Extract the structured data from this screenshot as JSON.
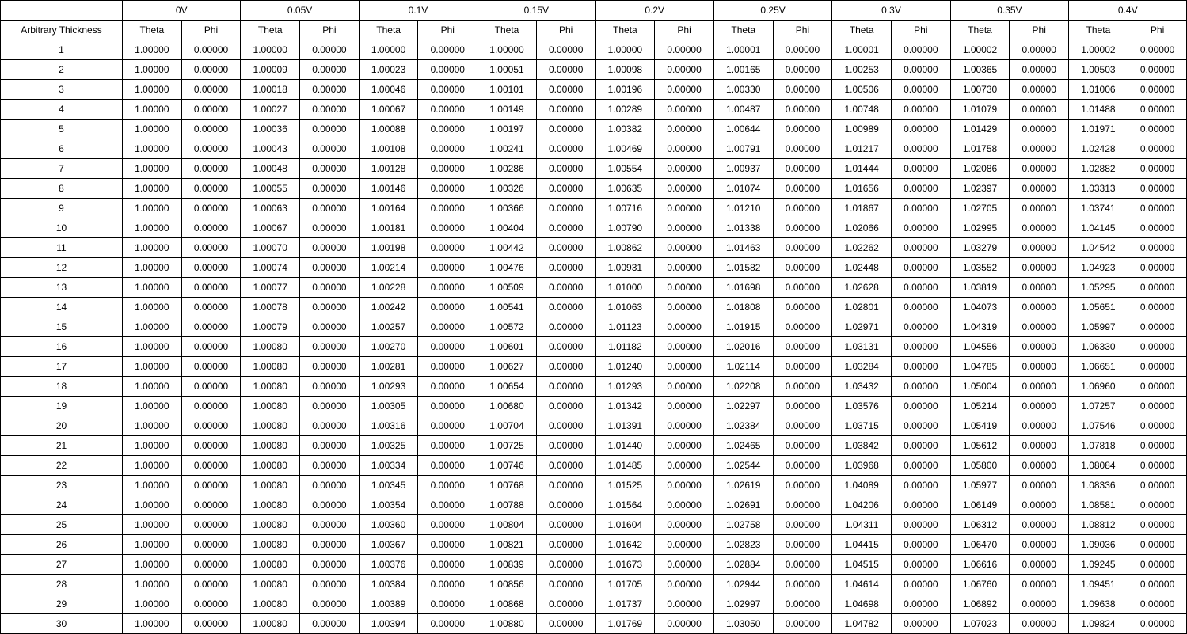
{
  "row_header_label": "Arbitrary Thickness",
  "voltages": [
    "0V",
    "0.05V",
    "0.1V",
    "0.15V",
    "0.2V",
    "0.25V",
    "0.3V",
    "0.35V",
    "0.4V"
  ],
  "sub_headers": [
    "Theta",
    "Phi"
  ],
  "row_labels": [
    "1",
    "2",
    "3",
    "4",
    "5",
    "6",
    "7",
    "8",
    "9",
    "10",
    "11",
    "12",
    "13",
    "14",
    "15",
    "16",
    "17",
    "18",
    "19",
    "20",
    "21",
    "22",
    "23",
    "24",
    "25",
    "26",
    "27",
    "28",
    "29",
    "30"
  ],
  "chart_data": {
    "type": "table",
    "title": "",
    "xlabel": "",
    "ylabel": "",
    "row_header": "Arbitrary Thickness",
    "column_groups": [
      "0V",
      "0.05V",
      "0.1V",
      "0.15V",
      "0.2V",
      "0.25V",
      "0.3V",
      "0.35V",
      "0.4V"
    ],
    "sub_columns": [
      "Theta",
      "Phi"
    ],
    "rows": [
      {
        "id": "1",
        "values": [
          "1.00000",
          "0.00000",
          "1.00000",
          "0.00000",
          "1.00000",
          "0.00000",
          "1.00000",
          "0.00000",
          "1.00000",
          "0.00000",
          "1.00001",
          "0.00000",
          "1.00001",
          "0.00000",
          "1.00002",
          "0.00000",
          "1.00002",
          "0.00000"
        ]
      },
      {
        "id": "2",
        "values": [
          "1.00000",
          "0.00000",
          "1.00009",
          "0.00000",
          "1.00023",
          "0.00000",
          "1.00051",
          "0.00000",
          "1.00098",
          "0.00000",
          "1.00165",
          "0.00000",
          "1.00253",
          "0.00000",
          "1.00365",
          "0.00000",
          "1.00503",
          "0.00000"
        ]
      },
      {
        "id": "3",
        "values": [
          "1.00000",
          "0.00000",
          "1.00018",
          "0.00000",
          "1.00046",
          "0.00000",
          "1.00101",
          "0.00000",
          "1.00196",
          "0.00000",
          "1.00330",
          "0.00000",
          "1.00506",
          "0.00000",
          "1.00730",
          "0.00000",
          "1.01006",
          "0.00000"
        ]
      },
      {
        "id": "4",
        "values": [
          "1.00000",
          "0.00000",
          "1.00027",
          "0.00000",
          "1.00067",
          "0.00000",
          "1.00149",
          "0.00000",
          "1.00289",
          "0.00000",
          "1.00487",
          "0.00000",
          "1.00748",
          "0.00000",
          "1.01079",
          "0.00000",
          "1.01488",
          "0.00000"
        ]
      },
      {
        "id": "5",
        "values": [
          "1.00000",
          "0.00000",
          "1.00036",
          "0.00000",
          "1.00088",
          "0.00000",
          "1.00197",
          "0.00000",
          "1.00382",
          "0.00000",
          "1.00644",
          "0.00000",
          "1.00989",
          "0.00000",
          "1.01429",
          "0.00000",
          "1.01971",
          "0.00000"
        ]
      },
      {
        "id": "6",
        "values": [
          "1.00000",
          "0.00000",
          "1.00043",
          "0.00000",
          "1.00108",
          "0.00000",
          "1.00241",
          "0.00000",
          "1.00469",
          "0.00000",
          "1.00791",
          "0.00000",
          "1.01217",
          "0.00000",
          "1.01758",
          "0.00000",
          "1.02428",
          "0.00000"
        ]
      },
      {
        "id": "7",
        "values": [
          "1.00000",
          "0.00000",
          "1.00048",
          "0.00000",
          "1.00128",
          "0.00000",
          "1.00286",
          "0.00000",
          "1.00554",
          "0.00000",
          "1.00937",
          "0.00000",
          "1.01444",
          "0.00000",
          "1.02086",
          "0.00000",
          "1.02882",
          "0.00000"
        ]
      },
      {
        "id": "8",
        "values": [
          "1.00000",
          "0.00000",
          "1.00055",
          "0.00000",
          "1.00146",
          "0.00000",
          "1.00326",
          "0.00000",
          "1.00635",
          "0.00000",
          "1.01074",
          "0.00000",
          "1.01656",
          "0.00000",
          "1.02397",
          "0.00000",
          "1.03313",
          "0.00000"
        ]
      },
      {
        "id": "9",
        "values": [
          "1.00000",
          "0.00000",
          "1.00063",
          "0.00000",
          "1.00164",
          "0.00000",
          "1.00366",
          "0.00000",
          "1.00716",
          "0.00000",
          "1.01210",
          "0.00000",
          "1.01867",
          "0.00000",
          "1.02705",
          "0.00000",
          "1.03741",
          "0.00000"
        ]
      },
      {
        "id": "10",
        "values": [
          "1.00000",
          "0.00000",
          "1.00067",
          "0.00000",
          "1.00181",
          "0.00000",
          "1.00404",
          "0.00000",
          "1.00790",
          "0.00000",
          "1.01338",
          "0.00000",
          "1.02066",
          "0.00000",
          "1.02995",
          "0.00000",
          "1.04145",
          "0.00000"
        ]
      },
      {
        "id": "11",
        "values": [
          "1.00000",
          "0.00000",
          "1.00070",
          "0.00000",
          "1.00198",
          "0.00000",
          "1.00442",
          "0.00000",
          "1.00862",
          "0.00000",
          "1.01463",
          "0.00000",
          "1.02262",
          "0.00000",
          "1.03279",
          "0.00000",
          "1.04542",
          "0.00000"
        ]
      },
      {
        "id": "12",
        "values": [
          "1.00000",
          "0.00000",
          "1.00074",
          "0.00000",
          "1.00214",
          "0.00000",
          "1.00476",
          "0.00000",
          "1.00931",
          "0.00000",
          "1.01582",
          "0.00000",
          "1.02448",
          "0.00000",
          "1.03552",
          "0.00000",
          "1.04923",
          "0.00000"
        ]
      },
      {
        "id": "13",
        "values": [
          "1.00000",
          "0.00000",
          "1.00077",
          "0.00000",
          "1.00228",
          "0.00000",
          "1.00509",
          "0.00000",
          "1.01000",
          "0.00000",
          "1.01698",
          "0.00000",
          "1.02628",
          "0.00000",
          "1.03819",
          "0.00000",
          "1.05295",
          "0.00000"
        ]
      },
      {
        "id": "14",
        "values": [
          "1.00000",
          "0.00000",
          "1.00078",
          "0.00000",
          "1.00242",
          "0.00000",
          "1.00541",
          "0.00000",
          "1.01063",
          "0.00000",
          "1.01808",
          "0.00000",
          "1.02801",
          "0.00000",
          "1.04073",
          "0.00000",
          "1.05651",
          "0.00000"
        ]
      },
      {
        "id": "15",
        "values": [
          "1.00000",
          "0.00000",
          "1.00079",
          "0.00000",
          "1.00257",
          "0.00000",
          "1.00572",
          "0.00000",
          "1.01123",
          "0.00000",
          "1.01915",
          "0.00000",
          "1.02971",
          "0.00000",
          "1.04319",
          "0.00000",
          "1.05997",
          "0.00000"
        ]
      },
      {
        "id": "16",
        "values": [
          "1.00000",
          "0.00000",
          "1.00080",
          "0.00000",
          "1.00270",
          "0.00000",
          "1.00601",
          "0.00000",
          "1.01182",
          "0.00000",
          "1.02016",
          "0.00000",
          "1.03131",
          "0.00000",
          "1.04556",
          "0.00000",
          "1.06330",
          "0.00000"
        ]
      },
      {
        "id": "17",
        "values": [
          "1.00000",
          "0.00000",
          "1.00080",
          "0.00000",
          "1.00281",
          "0.00000",
          "1.00627",
          "0.00000",
          "1.01240",
          "0.00000",
          "1.02114",
          "0.00000",
          "1.03284",
          "0.00000",
          "1.04785",
          "0.00000",
          "1.06651",
          "0.00000"
        ]
      },
      {
        "id": "18",
        "values": [
          "1.00000",
          "0.00000",
          "1.00080",
          "0.00000",
          "1.00293",
          "0.00000",
          "1.00654",
          "0.00000",
          "1.01293",
          "0.00000",
          "1.02208",
          "0.00000",
          "1.03432",
          "0.00000",
          "1.05004",
          "0.00000",
          "1.06960",
          "0.00000"
        ]
      },
      {
        "id": "19",
        "values": [
          "1.00000",
          "0.00000",
          "1.00080",
          "0.00000",
          "1.00305",
          "0.00000",
          "1.00680",
          "0.00000",
          "1.01342",
          "0.00000",
          "1.02297",
          "0.00000",
          "1.03576",
          "0.00000",
          "1.05214",
          "0.00000",
          "1.07257",
          "0.00000"
        ]
      },
      {
        "id": "20",
        "values": [
          "1.00000",
          "0.00000",
          "1.00080",
          "0.00000",
          "1.00316",
          "0.00000",
          "1.00704",
          "0.00000",
          "1.01391",
          "0.00000",
          "1.02384",
          "0.00000",
          "1.03715",
          "0.00000",
          "1.05419",
          "0.00000",
          "1.07546",
          "0.00000"
        ]
      },
      {
        "id": "21",
        "values": [
          "1.00000",
          "0.00000",
          "1.00080",
          "0.00000",
          "1.00325",
          "0.00000",
          "1.00725",
          "0.00000",
          "1.01440",
          "0.00000",
          "1.02465",
          "0.00000",
          "1.03842",
          "0.00000",
          "1.05612",
          "0.00000",
          "1.07818",
          "0.00000"
        ]
      },
      {
        "id": "22",
        "values": [
          "1.00000",
          "0.00000",
          "1.00080",
          "0.00000",
          "1.00334",
          "0.00000",
          "1.00746",
          "0.00000",
          "1.01485",
          "0.00000",
          "1.02544",
          "0.00000",
          "1.03968",
          "0.00000",
          "1.05800",
          "0.00000",
          "1.08084",
          "0.00000"
        ]
      },
      {
        "id": "23",
        "values": [
          "1.00000",
          "0.00000",
          "1.00080",
          "0.00000",
          "1.00345",
          "0.00000",
          "1.00768",
          "0.00000",
          "1.01525",
          "0.00000",
          "1.02619",
          "0.00000",
          "1.04089",
          "0.00000",
          "1.05977",
          "0.00000",
          "1.08336",
          "0.00000"
        ]
      },
      {
        "id": "24",
        "values": [
          "1.00000",
          "0.00000",
          "1.00080",
          "0.00000",
          "1.00354",
          "0.00000",
          "1.00788",
          "0.00000",
          "1.01564",
          "0.00000",
          "1.02691",
          "0.00000",
          "1.04206",
          "0.00000",
          "1.06149",
          "0.00000",
          "1.08581",
          "0.00000"
        ]
      },
      {
        "id": "25",
        "values": [
          "1.00000",
          "0.00000",
          "1.00080",
          "0.00000",
          "1.00360",
          "0.00000",
          "1.00804",
          "0.00000",
          "1.01604",
          "0.00000",
          "1.02758",
          "0.00000",
          "1.04311",
          "0.00000",
          "1.06312",
          "0.00000",
          "1.08812",
          "0.00000"
        ]
      },
      {
        "id": "26",
        "values": [
          "1.00000",
          "0.00000",
          "1.00080",
          "0.00000",
          "1.00367",
          "0.00000",
          "1.00821",
          "0.00000",
          "1.01642",
          "0.00000",
          "1.02823",
          "0.00000",
          "1.04415",
          "0.00000",
          "1.06470",
          "0.00000",
          "1.09036",
          "0.00000"
        ]
      },
      {
        "id": "27",
        "values": [
          "1.00000",
          "0.00000",
          "1.00080",
          "0.00000",
          "1.00376",
          "0.00000",
          "1.00839",
          "0.00000",
          "1.01673",
          "0.00000",
          "1.02884",
          "0.00000",
          "1.04515",
          "0.00000",
          "1.06616",
          "0.00000",
          "1.09245",
          "0.00000"
        ]
      },
      {
        "id": "28",
        "values": [
          "1.00000",
          "0.00000",
          "1.00080",
          "0.00000",
          "1.00384",
          "0.00000",
          "1.00856",
          "0.00000",
          "1.01705",
          "0.00000",
          "1.02944",
          "0.00000",
          "1.04614",
          "0.00000",
          "1.06760",
          "0.00000",
          "1.09451",
          "0.00000"
        ]
      },
      {
        "id": "29",
        "values": [
          "1.00000",
          "0.00000",
          "1.00080",
          "0.00000",
          "1.00389",
          "0.00000",
          "1.00868",
          "0.00000",
          "1.01737",
          "0.00000",
          "1.02997",
          "0.00000",
          "1.04698",
          "0.00000",
          "1.06892",
          "0.00000",
          "1.09638",
          "0.00000"
        ]
      },
      {
        "id": "30",
        "values": [
          "1.00000",
          "0.00000",
          "1.00080",
          "0.00000",
          "1.00394",
          "0.00000",
          "1.00880",
          "0.00000",
          "1.01769",
          "0.00000",
          "1.03050",
          "0.00000",
          "1.04782",
          "0.00000",
          "1.07023",
          "0.00000",
          "1.09824",
          "0.00000"
        ]
      }
    ]
  }
}
